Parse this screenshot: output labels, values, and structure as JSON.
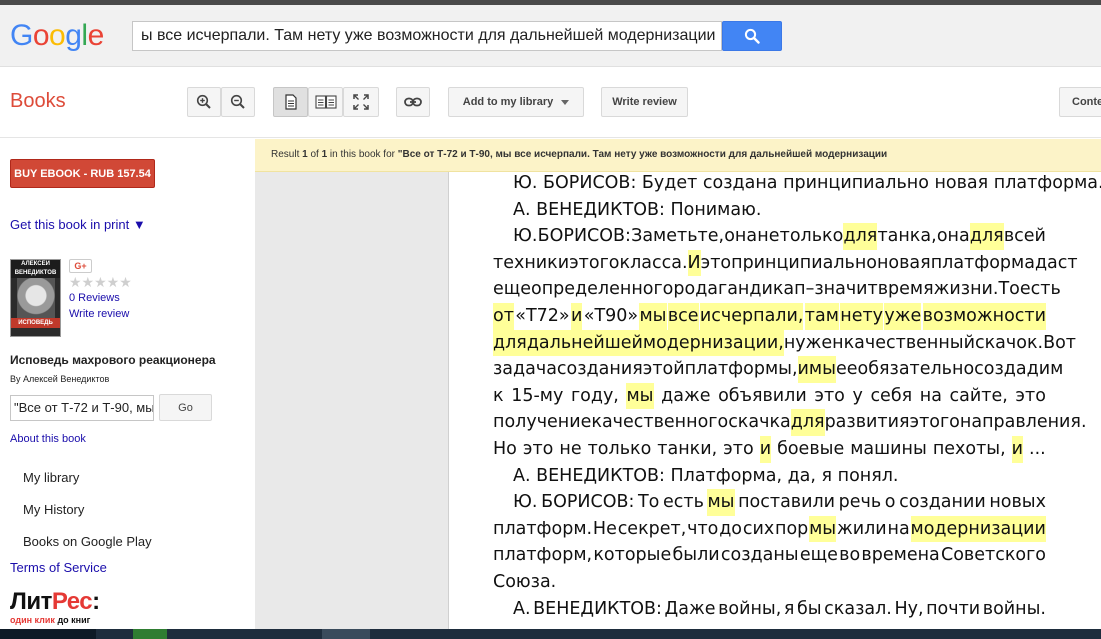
{
  "colors": {
    "brand_red": "#dd4b39",
    "search_blue": "#4285f4",
    "highlight": "#ffff99",
    "link": "#1a0dab"
  },
  "logo": {
    "letters": [
      "G",
      "o",
      "o",
      "g",
      "l",
      "e"
    ],
    "colors": [
      "#4285f4",
      "#ea4335",
      "#fbbc05",
      "#4285f4",
      "#34a853",
      "#ea4335"
    ]
  },
  "search": {
    "value": "ы все исчерпали. Там нету уже возможности для дальнейшей модернизации",
    "button_icon": "search-icon"
  },
  "toolbar": {
    "section_title": "Books",
    "add_library": "Add to my library",
    "write_review": "Write review",
    "contents": "Conte"
  },
  "sidebar": {
    "buy": "BUY EBOOK - RUB 157.54",
    "get_print": "Get this book in print ▼",
    "cover": {
      "author": "АЛЕКСЕЙ ВЕНЕДИКТОВ",
      "title": "ИСПОВЕДЬ"
    },
    "gplus": "G+",
    "stars": "★★★★★",
    "reviews": "0 Reviews",
    "write_review": "Write review",
    "book_title": "Исповедь махрового реакционера",
    "author": "By Алексей Венедиктов",
    "inbook_value": "\"Все от Т-72 и Т-90, мы",
    "go": "Go",
    "about": "About this book",
    "nav": [
      "My library",
      "My History",
      "Books on Google Play"
    ],
    "tos": "Terms of Service",
    "litres": {
      "name_a": "Лит",
      "name_b": "Рес",
      "name_c": ":",
      "tag_a": "один клик ",
      "tag_b": "до книг"
    }
  },
  "result_bar": {
    "prefix": "Result ",
    "current": "1",
    "of": " of ",
    "total": "1",
    "mid": " in this book for ",
    "query": "\"Все от Т-72 и Т-90, мы все исчерпали. Там нету уже возможности для дальнейшей модернизации"
  },
  "page": {
    "lines": [
      {
        "indent": true,
        "justify": false,
        "words": [
          [
            "Ю. БОРИСОВ: Будет создана принципиально новая платформа.",
            false
          ]
        ]
      },
      {
        "indent": true,
        "justify": false,
        "words": [
          [
            "А. ВЕНЕДИКТОВ: Понимаю.",
            false
          ]
        ]
      },
      {
        "indent": true,
        "justify": true,
        "words": [
          [
            "Ю.",
            false
          ],
          [
            "БОРИСОВ:",
            false
          ],
          [
            "Заметьте,",
            false
          ],
          [
            "она",
            false
          ],
          [
            "не",
            false
          ],
          [
            "только",
            false
          ],
          [
            "для",
            true
          ],
          [
            "танка,",
            false
          ],
          [
            "она",
            false
          ],
          [
            "для",
            true
          ],
          [
            "всей",
            false
          ]
        ]
      },
      {
        "indent": false,
        "justify": true,
        "words": [
          [
            "техники",
            false
          ],
          [
            "этого",
            false
          ],
          [
            "класса.",
            false
          ],
          [
            "И",
            true
          ],
          [
            "это",
            false
          ],
          [
            "принципиально",
            false
          ],
          [
            "новая",
            false
          ],
          [
            "платформа",
            false
          ],
          [
            "даст",
            false
          ]
        ]
      },
      {
        "indent": false,
        "justify": true,
        "words": [
          [
            "еще",
            false
          ],
          [
            "определенного",
            false
          ],
          [
            "рода",
            false
          ],
          [
            "гандикап",
            false
          ],
          [
            "–",
            false
          ],
          [
            "значит",
            false
          ],
          [
            "время",
            false
          ],
          [
            "жизни.",
            false
          ],
          [
            "То",
            false
          ],
          [
            "есть",
            false
          ]
        ]
      },
      {
        "indent": false,
        "justify": true,
        "words": [
          [
            "от",
            true
          ],
          [
            "«Т72»",
            false
          ],
          [
            "и",
            true
          ],
          [
            "«Т90»",
            false
          ],
          [
            "мы",
            true
          ],
          [
            "все",
            true
          ],
          [
            "исчерпали,",
            true
          ],
          [
            "там",
            true
          ],
          [
            "нету",
            true
          ],
          [
            "уже",
            true
          ],
          [
            "возможности",
            true
          ]
        ]
      },
      {
        "indent": false,
        "justify": true,
        "words": [
          [
            "для",
            true
          ],
          [
            "дальнейшей",
            true
          ],
          [
            "модернизации,",
            true
          ],
          [
            "нужен",
            false
          ],
          [
            "качественный",
            false
          ],
          [
            "скачок.",
            false
          ],
          [
            "Вот",
            false
          ]
        ]
      },
      {
        "indent": false,
        "justify": true,
        "words": [
          [
            "задача",
            false
          ],
          [
            "создания",
            false
          ],
          [
            "этой",
            false
          ],
          [
            "платформы,",
            false
          ],
          [
            "и",
            true
          ],
          [
            "мы",
            true
          ],
          [
            "ее",
            false
          ],
          [
            "обязательно",
            false
          ],
          [
            "создадим",
            false
          ]
        ]
      },
      {
        "indent": false,
        "justify": true,
        "words": [
          [
            "к",
            false
          ],
          [
            "15-му",
            false
          ],
          [
            "году,",
            false
          ],
          [
            "мы",
            true
          ],
          [
            "даже",
            false
          ],
          [
            "объявили",
            false
          ],
          [
            "это",
            false
          ],
          [
            "у",
            false
          ],
          [
            "себя",
            false
          ],
          [
            "на",
            false
          ],
          [
            "сайте,",
            false
          ],
          [
            "это",
            false
          ]
        ]
      },
      {
        "indent": false,
        "justify": true,
        "words": [
          [
            "получение",
            false
          ],
          [
            "качественного",
            false
          ],
          [
            "скачка",
            false
          ],
          [
            "для",
            true
          ],
          [
            "развития",
            false
          ],
          [
            "этого",
            false
          ],
          [
            "направления.",
            false
          ]
        ]
      },
      {
        "indent": false,
        "justify": false,
        "words": [
          [
            "Но",
            false
          ],
          [
            "это",
            false
          ],
          [
            "не",
            false
          ],
          [
            "только",
            false
          ],
          [
            "танки,",
            false
          ],
          [
            "это",
            false
          ],
          [
            "и",
            true
          ],
          [
            "боевые",
            false
          ],
          [
            "машины",
            false
          ],
          [
            "пехоты,",
            false
          ],
          [
            "и",
            true
          ],
          [
            "...",
            false
          ]
        ]
      },
      {
        "indent": true,
        "justify": false,
        "words": [
          [
            "А. ВЕНЕДИКТОВ: Платформа, да, я понял.",
            false
          ]
        ]
      },
      {
        "indent": true,
        "justify": true,
        "words": [
          [
            "Ю.",
            false
          ],
          [
            "БОРИСОВ:",
            false
          ],
          [
            "То",
            false
          ],
          [
            "есть",
            false
          ],
          [
            "мы",
            true
          ],
          [
            "поставили",
            false
          ],
          [
            "речь",
            false
          ],
          [
            "о",
            false
          ],
          [
            "создании",
            false
          ],
          [
            "новых",
            false
          ]
        ]
      },
      {
        "indent": false,
        "justify": true,
        "words": [
          [
            "платформ.",
            false
          ],
          [
            "Не",
            false
          ],
          [
            "секрет,",
            false
          ],
          [
            "что",
            false
          ],
          [
            "до",
            false
          ],
          [
            "сих",
            false
          ],
          [
            "пор",
            false
          ],
          [
            "мы",
            true
          ],
          [
            "жили",
            false
          ],
          [
            "на",
            false
          ],
          [
            "модернизации",
            true
          ]
        ]
      },
      {
        "indent": false,
        "justify": true,
        "words": [
          [
            "платформ,",
            false
          ],
          [
            "которые",
            false
          ],
          [
            "были",
            false
          ],
          [
            "созданы",
            false
          ],
          [
            "еще",
            false
          ],
          [
            "во",
            false
          ],
          [
            "времена",
            false
          ],
          [
            "Советского",
            false
          ]
        ]
      },
      {
        "indent": false,
        "justify": false,
        "words": [
          [
            "Союза.",
            false
          ]
        ]
      },
      {
        "indent": true,
        "justify": true,
        "words": [
          [
            "А.",
            false
          ],
          [
            "ВЕНЕДИКТОВ:",
            false
          ],
          [
            "Даже",
            false
          ],
          [
            "войны,",
            false
          ],
          [
            "я",
            false
          ],
          [
            "бы",
            false
          ],
          [
            "сказал.",
            false
          ],
          [
            "Ну,",
            false
          ],
          [
            "почти",
            false
          ],
          [
            "войны.",
            false
          ]
        ]
      }
    ]
  }
}
